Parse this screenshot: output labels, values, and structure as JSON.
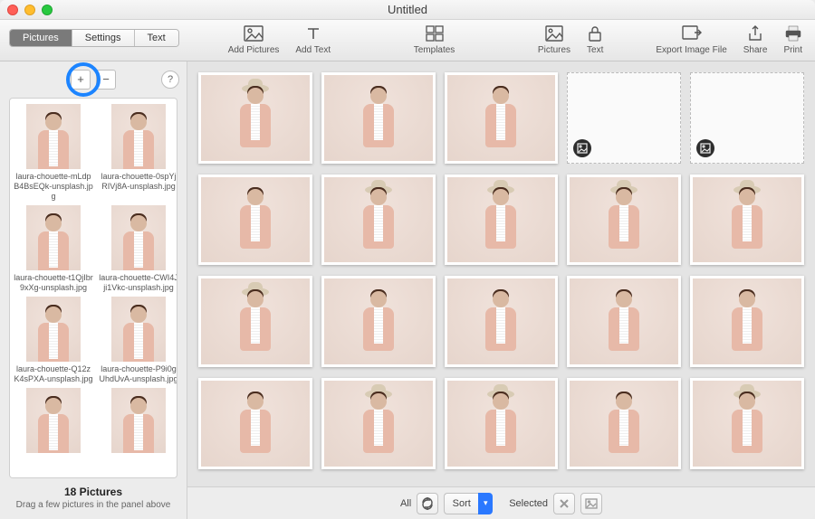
{
  "window": {
    "title": "Untitled"
  },
  "tabs": {
    "pictures": "Pictures",
    "settings": "Settings",
    "text": "Text",
    "active": "pictures"
  },
  "toolbar": {
    "add_pictures": "Add Pictures",
    "add_text": "Add Text",
    "templates": "Templates",
    "pictures": "Pictures",
    "text": "Text",
    "export": "Export Image File",
    "share": "Share",
    "print": "Print"
  },
  "sidebar": {
    "plus": "+",
    "minus": "−",
    "help": "?",
    "items": [
      {
        "label": "laura-chouette-mLdpB4BsEQk-unsplash.jpg",
        "hat": false
      },
      {
        "label": "laura-chouette-0spYjRIVj8A-unsplash.jpg",
        "hat": false
      },
      {
        "label": "laura-chouette-t1QjIbr9xXg-unsplash.jpg",
        "hat": false
      },
      {
        "label": "laura-chouette-CWI4Jji1Vkc-unsplash.jpg",
        "hat": false
      },
      {
        "label": "laura-chouette-Q12zK4sPXA-unsplash.jpg",
        "hat": false
      },
      {
        "label": "laura-chouette-P9i0gUhdUvA-unsplash.jpg",
        "hat": false
      },
      {
        "label": "",
        "hat": false
      },
      {
        "label": "",
        "hat": false
      }
    ],
    "count_label": "18 Pictures",
    "hint": "Drag a few pictures in the panel above"
  },
  "grid": {
    "cells": [
      {
        "hat": true
      },
      {
        "hat": false
      },
      {
        "hat": false
      },
      {
        "empty": true
      },
      {
        "empty": true
      },
      {
        "hat": false
      },
      {
        "hat": true
      },
      {
        "hat": true
      },
      {
        "hat": true
      },
      {
        "hat": true
      },
      {
        "hat": true
      },
      {
        "hat": false
      },
      {
        "hat": false
      },
      {
        "hat": false
      },
      {
        "hat": false
      },
      {
        "hat": false
      },
      {
        "hat": true
      },
      {
        "hat": true
      },
      {
        "hat": false
      },
      {
        "hat": true
      }
    ]
  },
  "bottombar": {
    "all": "All",
    "sort": "Sort",
    "selected": "Selected"
  }
}
